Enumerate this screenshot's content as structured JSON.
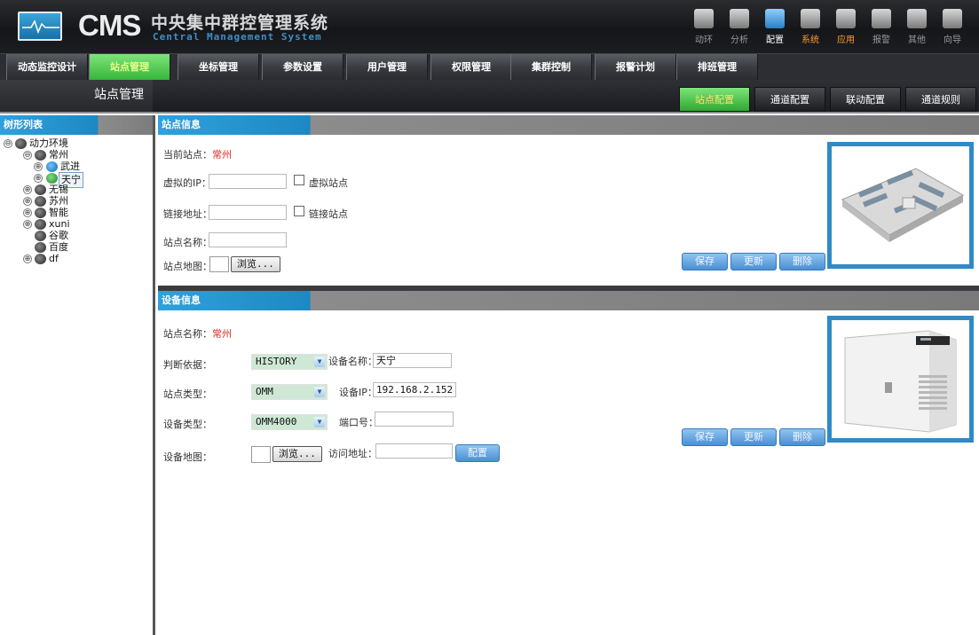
{
  "header": {
    "brand": "CMS",
    "title_cn": "中央集中群控管理系统",
    "title_en": "Central Management System",
    "quick_items": [
      {
        "label": "动环",
        "icon": "server-icon",
        "state": "normal"
      },
      {
        "label": "分析",
        "icon": "satellite-dish-icon",
        "state": "normal"
      },
      {
        "label": "配置",
        "icon": "config-icon",
        "state": "active"
      },
      {
        "label": "系统",
        "icon": "system-icon",
        "state": "highlight"
      },
      {
        "label": "应用",
        "icon": "apps-icon",
        "state": "highlight"
      },
      {
        "label": "报警",
        "icon": "alarm-icon",
        "state": "normal"
      },
      {
        "label": "其他",
        "icon": "other-icon",
        "state": "normal"
      },
      {
        "label": "向导",
        "icon": "wizard-icon",
        "state": "normal"
      }
    ]
  },
  "menu": {
    "items": [
      "动态监控设计",
      "站点管理",
      "坐标管理",
      "参数设置",
      "用户管理",
      "权限管理",
      "集群控制",
      "报警计划",
      "排班管理"
    ],
    "active_index": 1
  },
  "subbar": {
    "page_title": "站点管理",
    "tabs": [
      "站点配置",
      "通道配置",
      "联动配置",
      "通道规则"
    ],
    "active_tab": 0
  },
  "tree": {
    "header": "树形列表",
    "nodes": [
      {
        "label": "动力环境",
        "toggle": "⊖"
      },
      {
        "label": "常州",
        "toggle": "⊖"
      },
      {
        "label": "武进",
        "toggle": "⊕"
      },
      {
        "label": "天宁",
        "toggle": "⊕"
      },
      {
        "label": "无锡",
        "toggle": "⊕"
      },
      {
        "label": "苏州",
        "toggle": "⊕"
      },
      {
        "label": "智能",
        "toggle": "⊕"
      },
      {
        "label": "xuni",
        "toggle": "⊕"
      },
      {
        "label": "谷歌",
        "toggle": ""
      },
      {
        "label": "百度",
        "toggle": ""
      },
      {
        "label": "df",
        "toggle": "⊕"
      }
    ]
  },
  "station": {
    "header": "站点信息",
    "current_label": "当前站点：",
    "current_value": "常州",
    "virtual_ip_label": "虚拟的IP：",
    "virtual_ip_value": "",
    "virtual_site_label": "虚拟站点",
    "link_label": "链接地址：",
    "link_value": "",
    "link_site_label": "链接站点",
    "name_label": "站点名称：",
    "name_value": "",
    "map_label": "站点地图：",
    "browse": "浏览...",
    "save": "保存",
    "update": "更新",
    "delete": "删除"
  },
  "device": {
    "header": "设备信息",
    "site_label": "站点名称：",
    "site_value": "常州",
    "basis_label": "判断依据：",
    "basis_value": "HISTORY",
    "dev_name_label": "设备名称：",
    "dev_name_value": "天宁",
    "site_type_label": "站点类型：",
    "site_type_value": "OMM",
    "dev_ip_label": "设备IP：",
    "dev_ip_value": "192.168.2.152",
    "dev_type_label": "设备类型：",
    "dev_type_value": "OMM4000",
    "port_label": "端口号：",
    "port_value": "",
    "dev_map_label": "设备地图：",
    "browse": "浏览...",
    "url_label": "访问地址：",
    "url_value": "",
    "config": "配置",
    "save": "保存",
    "update": "更新",
    "delete": "删除"
  },
  "colors": {
    "accent_blue": "#2fa1dc",
    "active_green": "#36b63a",
    "highlight_orange": "#ff9a2a",
    "value_red": "#dd2a20"
  }
}
